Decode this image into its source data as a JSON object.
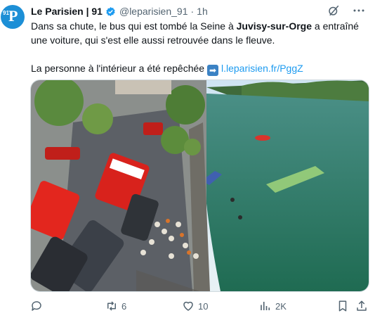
{
  "author": {
    "avatar_label": "91",
    "avatar_mark": "P",
    "name": "Le Parisien | 91",
    "handle": "@leparisien_91",
    "separator": "·",
    "time": "1h"
  },
  "tweet": {
    "line1_pre": "Dans sa chute, le bus qui est tombé la Seine à ",
    "line1_bold": "Juvisy-sur-Orge",
    "line1_post": " a entraîné une voiture, qui s'est elle aussi retrouvée dans le fleuve.",
    "line2_text": "La personne à l'intérieur a été repêchée ",
    "line2_emoji": "➡",
    "line2_link": "l.leparisien.fr/PggZ"
  },
  "actions": {
    "replies": "",
    "reposts": "6",
    "likes": "10",
    "views": "2K"
  },
  "icons": [
    "verified-badge-icon",
    "grok-icon",
    "more-icon",
    "reply-icon",
    "repost-icon",
    "like-icon",
    "views-icon",
    "bookmark-icon",
    "share-icon"
  ],
  "colors": {
    "accent": "#1d9bf0",
    "muted": "#536471",
    "avatar": "#1d8fd6",
    "water": "#2f7d66",
    "bus_roof": "#9bd07a"
  }
}
